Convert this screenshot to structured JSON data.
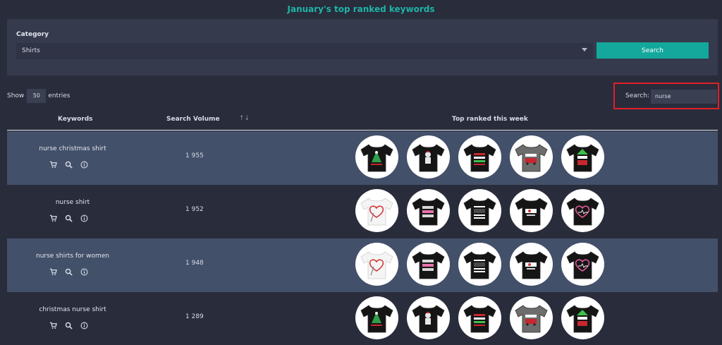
{
  "page": {
    "title": "January's top ranked keywords"
  },
  "filter": {
    "category_label": "Category",
    "category_value": "Shirts",
    "search_button": "Search"
  },
  "table_controls": {
    "show_label": "Show",
    "length_value": "50",
    "entries_label": "entries",
    "search_label": "Search:",
    "search_value": "nurse"
  },
  "table": {
    "headers": [
      "Keywords",
      "Search Volume",
      "Top ranked this week"
    ],
    "sort_icon": "↑↓",
    "rows": [
      {
        "keyword": "nurse christmas shirt",
        "volume": "1 955",
        "thumbs": [
          "black-shirt-nurse-tree",
          "black-shirt-cat-nurse",
          "black-shirt-ugly-sweater",
          "gray-shirt-jolliest-truck",
          "black-shirt-nurse-elf"
        ]
      },
      {
        "keyword": "nurse shirt",
        "volume": "1 952",
        "thumbs": [
          "white-shirt-heart-stethoscope",
          "black-shirt-coffee-scrubs",
          "black-shirt-what-exactly",
          "black-shirt-love-nurse",
          "black-shirt-heart-line"
        ]
      },
      {
        "keyword": "nurse shirts for women",
        "volume": "1 948",
        "thumbs": [
          "white-shirt-heart-stethoscope",
          "black-shirt-coffee-scrubs",
          "black-shirt-what-exactly",
          "black-shirt-love-nurse",
          "black-shirt-heart-line"
        ]
      },
      {
        "keyword": "christmas nurse shirt",
        "volume": "1 289",
        "thumbs": [
          "black-shirt-nurse-tree",
          "black-shirt-cat-nurse",
          "black-shirt-ugly-sweater",
          "gray-shirt-jolliest-truck",
          "black-shirt-nurse-elf"
        ]
      }
    ],
    "row_icons": [
      "cart-icon",
      "search-icon",
      "info-icon"
    ]
  },
  "colors": {
    "accent": "#14a89c",
    "title": "#1fb3a6",
    "highlight": "#e0202a",
    "row_alt": "#43506a",
    "background": "#292c3b"
  }
}
